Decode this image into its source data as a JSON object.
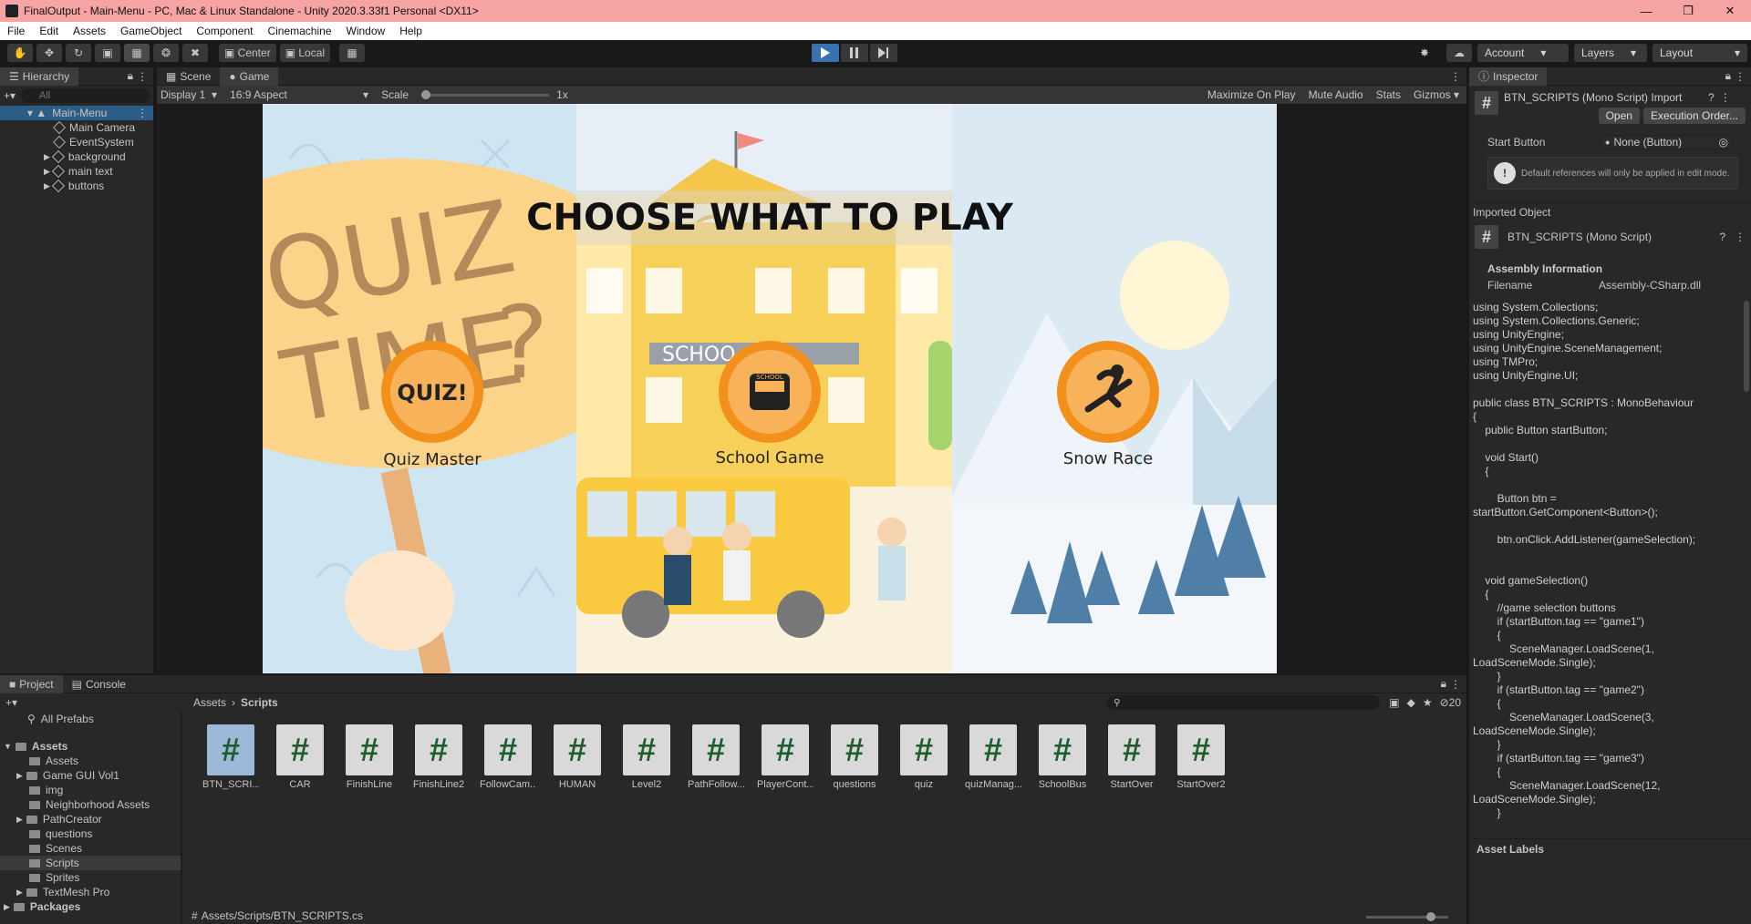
{
  "window": {
    "title": "FinalOutput - Main-Menu - PC, Mac & Linux Standalone - Unity 2020.3.33f1 Personal <DX11>"
  },
  "menu": [
    "File",
    "Edit",
    "Assets",
    "GameObject",
    "Component",
    "Cinemachine",
    "Window",
    "Help"
  ],
  "toolbar": {
    "center_label": "Center",
    "local_label": "Local",
    "account_label": "Account",
    "layers_label": "Layers",
    "layout_label": "Layout"
  },
  "hierarchy": {
    "tab_label": "Hierarchy",
    "search_placeholder": "All",
    "root": "Main-Menu",
    "items": [
      "Main Camera",
      "EventSystem",
      "background",
      "main text",
      "buttons"
    ]
  },
  "game_view": {
    "tabs": [
      "Scene",
      "Game"
    ],
    "display": "Display 1",
    "aspect": "16:9 Aspect",
    "scale_label": "Scale",
    "scale_value": "1x",
    "right_options": [
      "Maximize On Play",
      "Mute Audio",
      "Stats",
      "Gizmos"
    ],
    "heading": "CHOOSE WHAT TO PLAY",
    "buttons": [
      {
        "label": "Quiz Master",
        "badge": "QUIZ!"
      },
      {
        "label": "School Game",
        "badge": "SCHOOL"
      },
      {
        "label": "Snow Race",
        "badge": ""
      }
    ],
    "sign_words": [
      "QUIZ",
      "TIME",
      "?"
    ],
    "school_sign": "SCHOO"
  },
  "inspector": {
    "tab_label": "Inspector",
    "script_title": "BTN_SCRIPTS (Mono Script) Import",
    "open_label": "Open",
    "exec_order_label": "Execution Order...",
    "start_button_label": "Start Button",
    "start_button_value": "None (Button)",
    "warning": "Default references will only be applied in edit mode.",
    "imported_object_label": "Imported Object",
    "imported_title": "BTN_SCRIPTS (Mono Script)",
    "assembly_heading": "Assembly Information",
    "filename_label": "Filename",
    "filename_value": "Assembly-CSharp.dll",
    "code": "using System.Collections;\nusing System.Collections.Generic;\nusing UnityEngine;\nusing UnityEngine.SceneManagement;\nusing TMPro;\nusing UnityEngine.UI;\n\npublic class BTN_SCRIPTS : MonoBehaviour\n{\n    public Button startButton;\n\n    void Start()\n    {\n\n        Button btn =\nstartButton.GetComponent<Button>();\n\n        btn.onClick.AddListener(gameSelection);\n\n\n    void gameSelection()\n    {\n        //game selection buttons\n        if (startButton.tag == \"game1\")\n        {\n            SceneManager.LoadScene(1,\nLoadSceneMode.Single);\n        }\n        if (startButton.tag == \"game2\")\n        {\n            SceneManager.LoadScene(3,\nLoadSceneMode.Single);\n        }\n        if (startButton.tag == \"game3\")\n        {\n            SceneManager.LoadScene(12,\nLoadSceneMode.Single);\n        }",
    "asset_labels": "Asset Labels"
  },
  "project": {
    "tabs": [
      "Project",
      "Console"
    ],
    "all_prefabs": "All Prefabs",
    "breadcrumb": [
      "Assets",
      "Scripts"
    ],
    "hidden_count": "20",
    "tree": {
      "root": "Assets",
      "children": [
        "Assets",
        "Game GUI Vol1",
        "img",
        "Neighborhood Assets",
        "PathCreator",
        "questions",
        "Scenes",
        "Scripts",
        "Sprites",
        "TextMesh Pro"
      ],
      "packages": "Packages"
    },
    "assets": [
      "BTN_SCRI...",
      "CAR",
      "FinishLine",
      "FinishLine2",
      "FollowCam...",
      "HUMAN",
      "Level2",
      "PathFollow...",
      "PlayerCont...",
      "questions",
      "quiz",
      "quizManag...",
      "SchoolBus",
      "StartOver",
      "StartOver2"
    ],
    "status_path": "Assets/Scripts/BTN_SCRIPTS.cs"
  },
  "colors": {
    "accent": "#3a72b0",
    "title_bar": "#f5a3a3",
    "selection": "#2c5d87",
    "game_orange": "#f3901c"
  }
}
